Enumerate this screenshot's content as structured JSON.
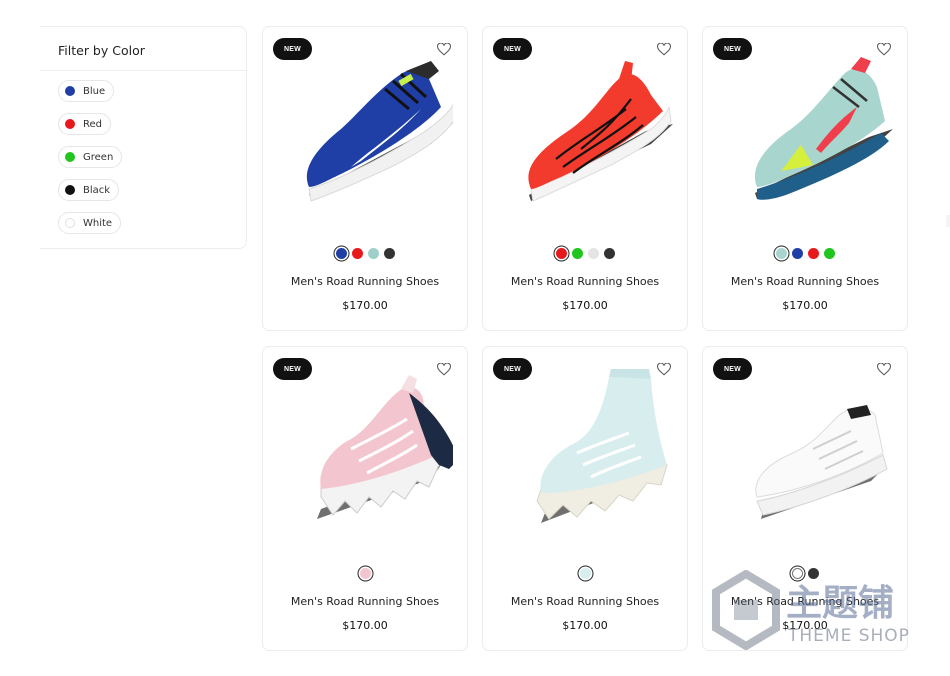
{
  "filter": {
    "title": "Filter by Color",
    "options": [
      {
        "label": "Blue",
        "color": "#1f3fa6"
      },
      {
        "label": "Red",
        "color": "#e8191c"
      },
      {
        "label": "Green",
        "color": "#22c51d"
      },
      {
        "label": "Black",
        "color": "#111111"
      },
      {
        "label": "White",
        "color": "#ffffff"
      }
    ]
  },
  "products": [
    {
      "badge": "NEW",
      "title": "Men's Road Running Shoes",
      "price": "$170.00",
      "swatches": [
        "#1f3fa6",
        "#e8191c",
        "#9ecfca",
        "#333333"
      ]
    },
    {
      "badge": "NEW",
      "title": "Men's Road Running Shoes",
      "price": "$170.00",
      "swatches": [
        "#e8191c",
        "#22c51d",
        "#e4e4e4",
        "#333333"
      ]
    },
    {
      "badge": "NEW",
      "title": "Men's Road Running Shoes",
      "price": "$170.00",
      "swatches": [
        "#a8d6ce",
        "#1f3fa6",
        "#e8191c",
        "#22c51d"
      ]
    },
    {
      "badge": "NEW",
      "title": "Men's Road Running Shoes",
      "price": "$170.00",
      "swatches": [
        "#f3c6cf"
      ]
    },
    {
      "badge": "NEW",
      "title": "Men's Road Running Shoes",
      "price": "$170.00",
      "swatches": [
        "#d8eeee"
      ]
    },
    {
      "badge": "NEW",
      "title": "Men's Road Running Shoes",
      "price": "$170.00",
      "swatches": [
        "#ffffff",
        "#333333"
      ]
    }
  ],
  "watermark": {
    "cn": "主题铺",
    "en": "THEME SHOP"
  }
}
